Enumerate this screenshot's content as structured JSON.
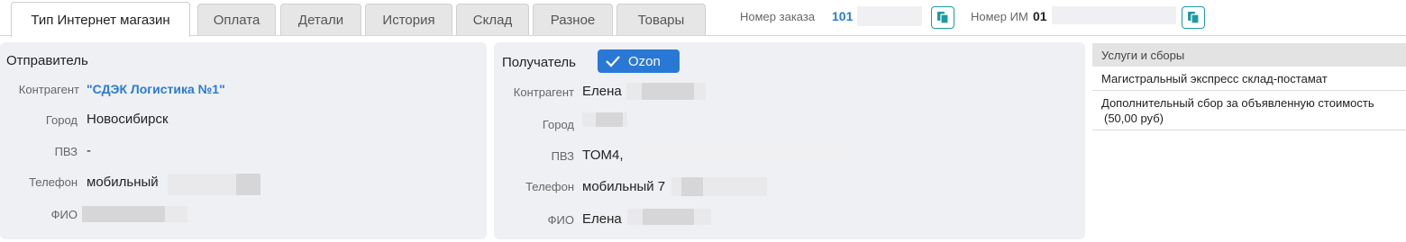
{
  "tabs": [
    {
      "label": "Тип Интернет магазин",
      "active": true
    },
    {
      "label": "Оплата",
      "active": false
    },
    {
      "label": "Детали",
      "active": false
    },
    {
      "label": "История",
      "active": false
    },
    {
      "label": "Склад",
      "active": false
    },
    {
      "label": "Разное",
      "active": false
    },
    {
      "label": "Товары",
      "active": false
    }
  ],
  "header": {
    "order_label": "Номер заказа",
    "order_value": "101",
    "im_label": "Номер ИМ",
    "im_value": "01"
  },
  "sender": {
    "title": "Отправитель",
    "contractor_label": "Контрагент",
    "contractor_value": "\"СДЭК Логистика №1\"",
    "city_label": "Город",
    "city_value": "Новосибирск",
    "pvz_label": "ПВЗ",
    "pvz_value": "-",
    "phone_label": "Телефон",
    "phone_value": "мобильный",
    "fio_label": "ФИО",
    "fio_value": ""
  },
  "recipient": {
    "title": "Получатель",
    "badge": "Ozon",
    "contractor_label": "Контрагент",
    "contractor_value": "Елена",
    "city_label": "Город",
    "city_value": "",
    "pvz_label": "ПВЗ",
    "pvz_value": "TOM4,",
    "phone_label": "Телефон",
    "phone_value": "мобильный 7",
    "fio_label": "ФИО",
    "fio_value": "Елена"
  },
  "services": {
    "header": "Услуги и сборы",
    "items": [
      {
        "line1": "Магистральный экспресс склад-постамат",
        "line2": ""
      },
      {
        "line1": "Дополнительный сбор за объявленную стоимость",
        "line2": "(50,00 руб)"
      }
    ]
  },
  "colors": {
    "accent": "#2a7bd5",
    "copy_icon": "#1f9aa3",
    "ozon": "#2a78d6",
    "panel_bg": "#eef0f3"
  }
}
